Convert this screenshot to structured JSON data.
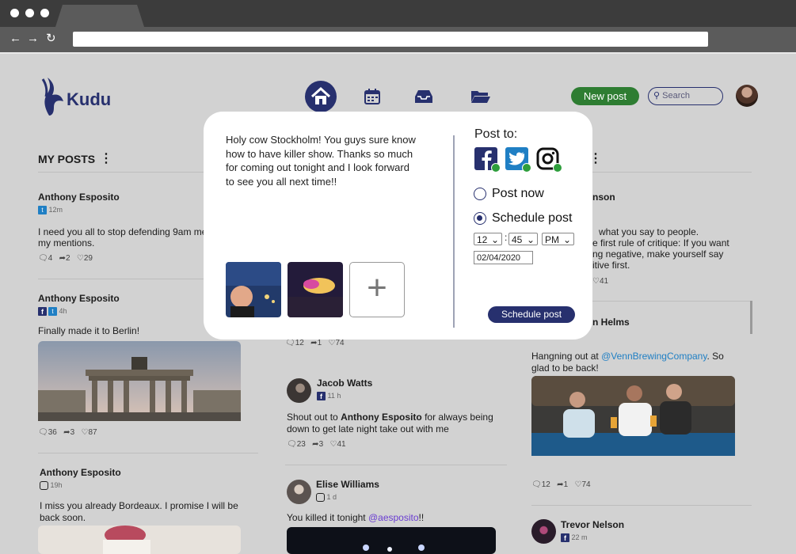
{
  "brand": {
    "name": "Kudu"
  },
  "header": {
    "new_post": "New post",
    "search_placeholder": "Search"
  },
  "colors": {
    "brand": "#27306e",
    "accent_green": "#2e7d32",
    "twitter": "#1f7fc4"
  },
  "nav_icons": [
    "home-icon",
    "calendar-icon",
    "inbox-icon",
    "folder-icon"
  ],
  "left": {
    "title": "MY POSTS",
    "posts": [
      {
        "author": "Anthony Esposito",
        "time": "12m",
        "text": "I need you all to stop defending 9am me",
        "text2": "my mentions.",
        "comments": "4",
        "shares": "2",
        "likes": "29"
      },
      {
        "author": "Anthony Esposito",
        "time": "4h",
        "text": "Finally made it to Berlin!",
        "comments": "36",
        "shares": "3",
        "likes": "87"
      },
      {
        "author": "Anthony Esposito",
        "time": "19h",
        "text": "I miss you already Bordeaux. I promise I will be back soon."
      }
    ]
  },
  "middle": {
    "top_stats": {
      "comments": "12",
      "shares": "1",
      "likes": "74"
    },
    "posts": [
      {
        "author": "Jacob Watts",
        "time": "11 h",
        "text_a": "Shout out to ",
        "mention": "Anthony Esposito",
        "text_b": " for always being",
        "text_c": "down to get late night take out with me",
        "comments": "23",
        "shares": "3",
        "likes": "41"
      },
      {
        "author": "Elise Williams",
        "time": "1 d",
        "text_a": "You killed it tonight ",
        "mention": "@aesposito",
        "text_b": "!!"
      }
    ]
  },
  "right": {
    "partial_name": "nson",
    "partial_lines": [
      "what you say to people.",
      "e first rule of critique: If you want",
      "ng negative, make yourself say",
      "itive first."
    ],
    "likes_top": "41",
    "post2_name_partial": "n Helms",
    "post2_text_a": "Hangning out at ",
    "post2_link": "@VennBrewingCompany",
    "post2_text_b": ". So",
    "post2_text_c": "glad to be back!",
    "post2_stats": {
      "comments": "12",
      "shares": "1",
      "likes": "74"
    },
    "post3_author": "Trevor Nelson",
    "post3_time": "22 m"
  },
  "modal": {
    "message": "Holy cow Stockholm! You guys sure know how to have killer show. Thanks so much for coming out tonight and I look forward to see you all next time!!",
    "message_lines": [
      "Holy cow Stockholm! You guys sure know",
      "how to have killer show. Thanks so much",
      "for coming out tonight and I look forward",
      "to see you all next time!!"
    ],
    "add_glyph": "+",
    "post_to_label": "Post to:",
    "networks": [
      "facebook",
      "twitter",
      "instagram"
    ],
    "post_now": "Post now",
    "schedule_post": "Schedule post",
    "hour": "12",
    "minute": "45",
    "ampm": "PM",
    "date": "02/04/2020",
    "schedule_button": "Schedule post"
  }
}
